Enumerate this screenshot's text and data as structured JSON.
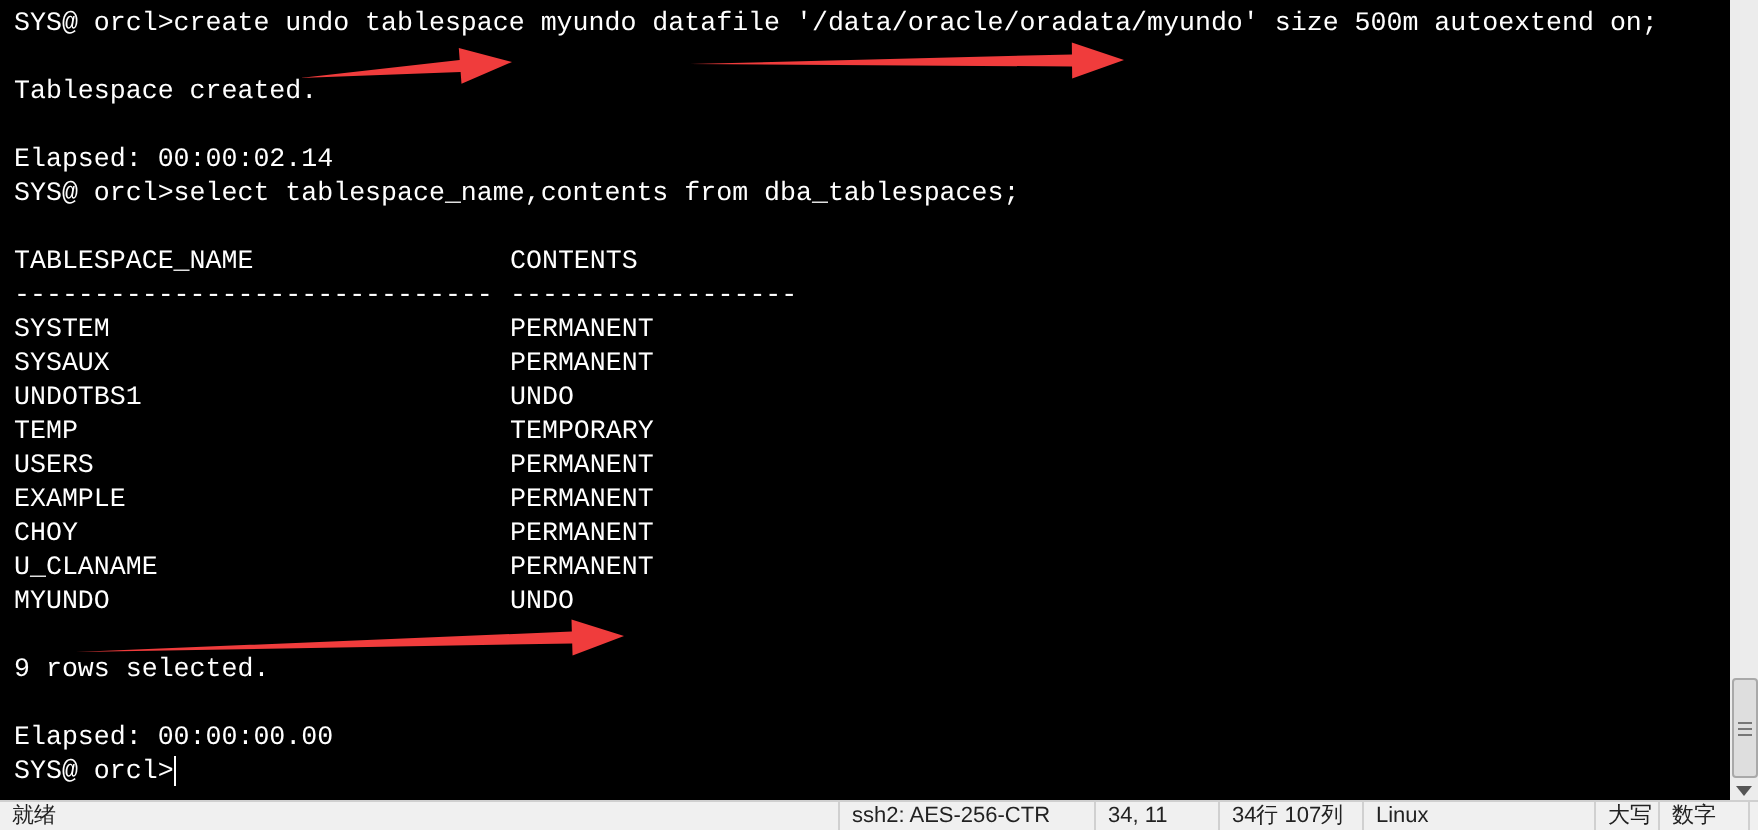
{
  "terminal": {
    "lines": [
      {
        "kind": "command",
        "prompt": "SYS@ orcl>",
        "text": "create undo tablespace myundo datafile '/data/oracle/oradata/myundo' size 500m autoextend on;"
      },
      {
        "kind": "blank"
      },
      {
        "kind": "output",
        "text": "Tablespace created."
      },
      {
        "kind": "blank"
      },
      {
        "kind": "output",
        "text": "Elapsed: 00:00:02.14"
      },
      {
        "kind": "command",
        "prompt": "SYS@ orcl>",
        "text": "select tablespace_name,contents from dba_tablespaces;"
      },
      {
        "kind": "blank"
      },
      {
        "kind": "table",
        "columns": [
          "TABLESPACE_NAME",
          "CONTENTS"
        ],
        "dividers": [
          "------------------------------",
          "------------------"
        ],
        "rows": [
          [
            "SYSTEM",
            "PERMANENT"
          ],
          [
            "SYSAUX",
            "PERMANENT"
          ],
          [
            "UNDOTBS1",
            "UNDO"
          ],
          [
            "TEMP",
            "TEMPORARY"
          ],
          [
            "USERS",
            "PERMANENT"
          ],
          [
            "EXAMPLE",
            "PERMANENT"
          ],
          [
            "CHOY",
            "PERMANENT"
          ],
          [
            "U_CLANAME",
            "PERMANENT"
          ],
          [
            "MYUNDO",
            "UNDO"
          ]
        ]
      },
      {
        "kind": "blank"
      },
      {
        "kind": "output",
        "text": "9 rows selected."
      },
      {
        "kind": "blank"
      },
      {
        "kind": "output",
        "text": "Elapsed: 00:00:00.00"
      },
      {
        "kind": "prompt",
        "prompt": "SYS@ orcl>"
      }
    ]
  },
  "status_bar": {
    "items": [
      "就绪",
      "ssh2: AES-256-CTR",
      "34, 11",
      "34行 107列",
      "Linux",
      "大写",
      "数字"
    ]
  }
}
